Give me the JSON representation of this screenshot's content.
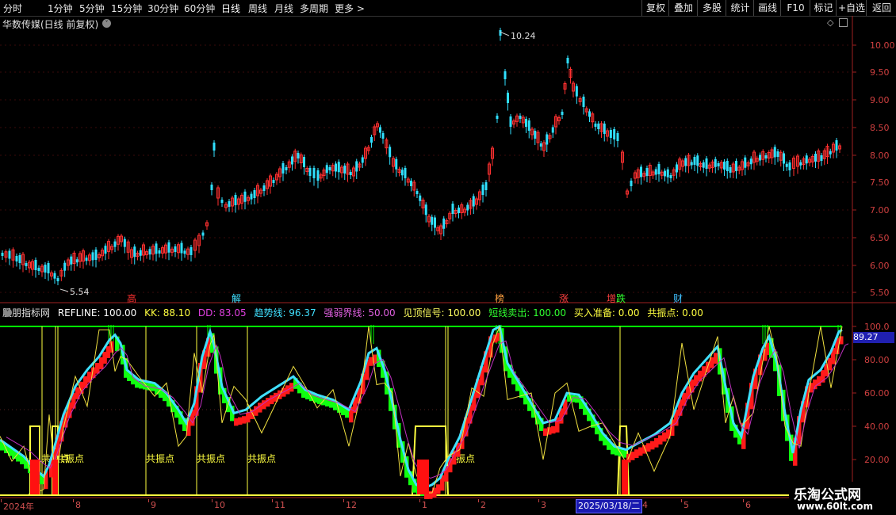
{
  "toolbar": {
    "periods": [
      "分时",
      "1分钟",
      "5分钟",
      "15分钟",
      "30分钟",
      "60分钟",
      "日线",
      "周线",
      "月线",
      "多周期",
      "更多 >"
    ],
    "active_period": "日线",
    "buttons": [
      "复权",
      "叠加",
      "多股",
      "统计",
      "画线",
      "F10",
      "标记",
      "+自选",
      "返回"
    ]
  },
  "stock": {
    "title": "华数传媒(日线 前复权)",
    "price_axis": [
      "10.00",
      "9.50",
      "9.00",
      "8.50",
      "8.00",
      "7.50",
      "7.00",
      "6.50",
      "6.00",
      "5.50"
    ],
    "high_label": "10.24",
    "low_label": "5.54",
    "events": [
      {
        "label": "高",
        "color": "#ff3030"
      },
      {
        "label": "解",
        "color": "#40e0ff"
      },
      {
        "label": "榜",
        "color": "#ffa040"
      },
      {
        "label": "涨",
        "color": "#ff4040"
      },
      {
        "label": "增",
        "color": "#ff4040"
      },
      {
        "label": "跌",
        "color": "#30ff30"
      },
      {
        "label": "财",
        "color": "#40c0ff"
      }
    ]
  },
  "indicator": {
    "name": "股朋指标网",
    "items": [
      {
        "label": "REFLINE: 100.00",
        "color": "#ffffff"
      },
      {
        "label": "KK: 88.10",
        "color": "#ffff40"
      },
      {
        "label": "DD: 83.05",
        "color": "#e040e0"
      },
      {
        "label": "趋势线: 96.37",
        "color": "#40e0ff"
      },
      {
        "label": "强弱界线: 50.00",
        "color": "#e060e0"
      },
      {
        "label": "见顶信号: 100.00",
        "color": "#ffff60"
      },
      {
        "label": "短线卖出: 100.00",
        "color": "#30ff30"
      },
      {
        "label": "买入准备: 0.00",
        "color": "#ffff40"
      },
      {
        "label": "共振点: 0.00",
        "color": "#ffff40"
      }
    ],
    "axis": [
      "100.0",
      "80.00",
      "60.00",
      "40.00",
      "20.00"
    ],
    "current_value": "89.27",
    "resonance_label": "共振点"
  },
  "dates": {
    "labels": [
      "2024年",
      "8",
      "9",
      "10",
      "11",
      "12",
      "1",
      "2",
      "3",
      "4",
      "5",
      "6"
    ],
    "cursor_date": "2025/03/18/二"
  },
  "watermark": {
    "line1": "乐淘公式网",
    "line2": "www.60lt.com"
  },
  "colors": {
    "up": "#ff3030",
    "down": "#30e0ff",
    "green": "#00ff00",
    "yellow": "#ffff40",
    "magenta": "#d040d0",
    "cyan": "#40e0ff"
  }
}
